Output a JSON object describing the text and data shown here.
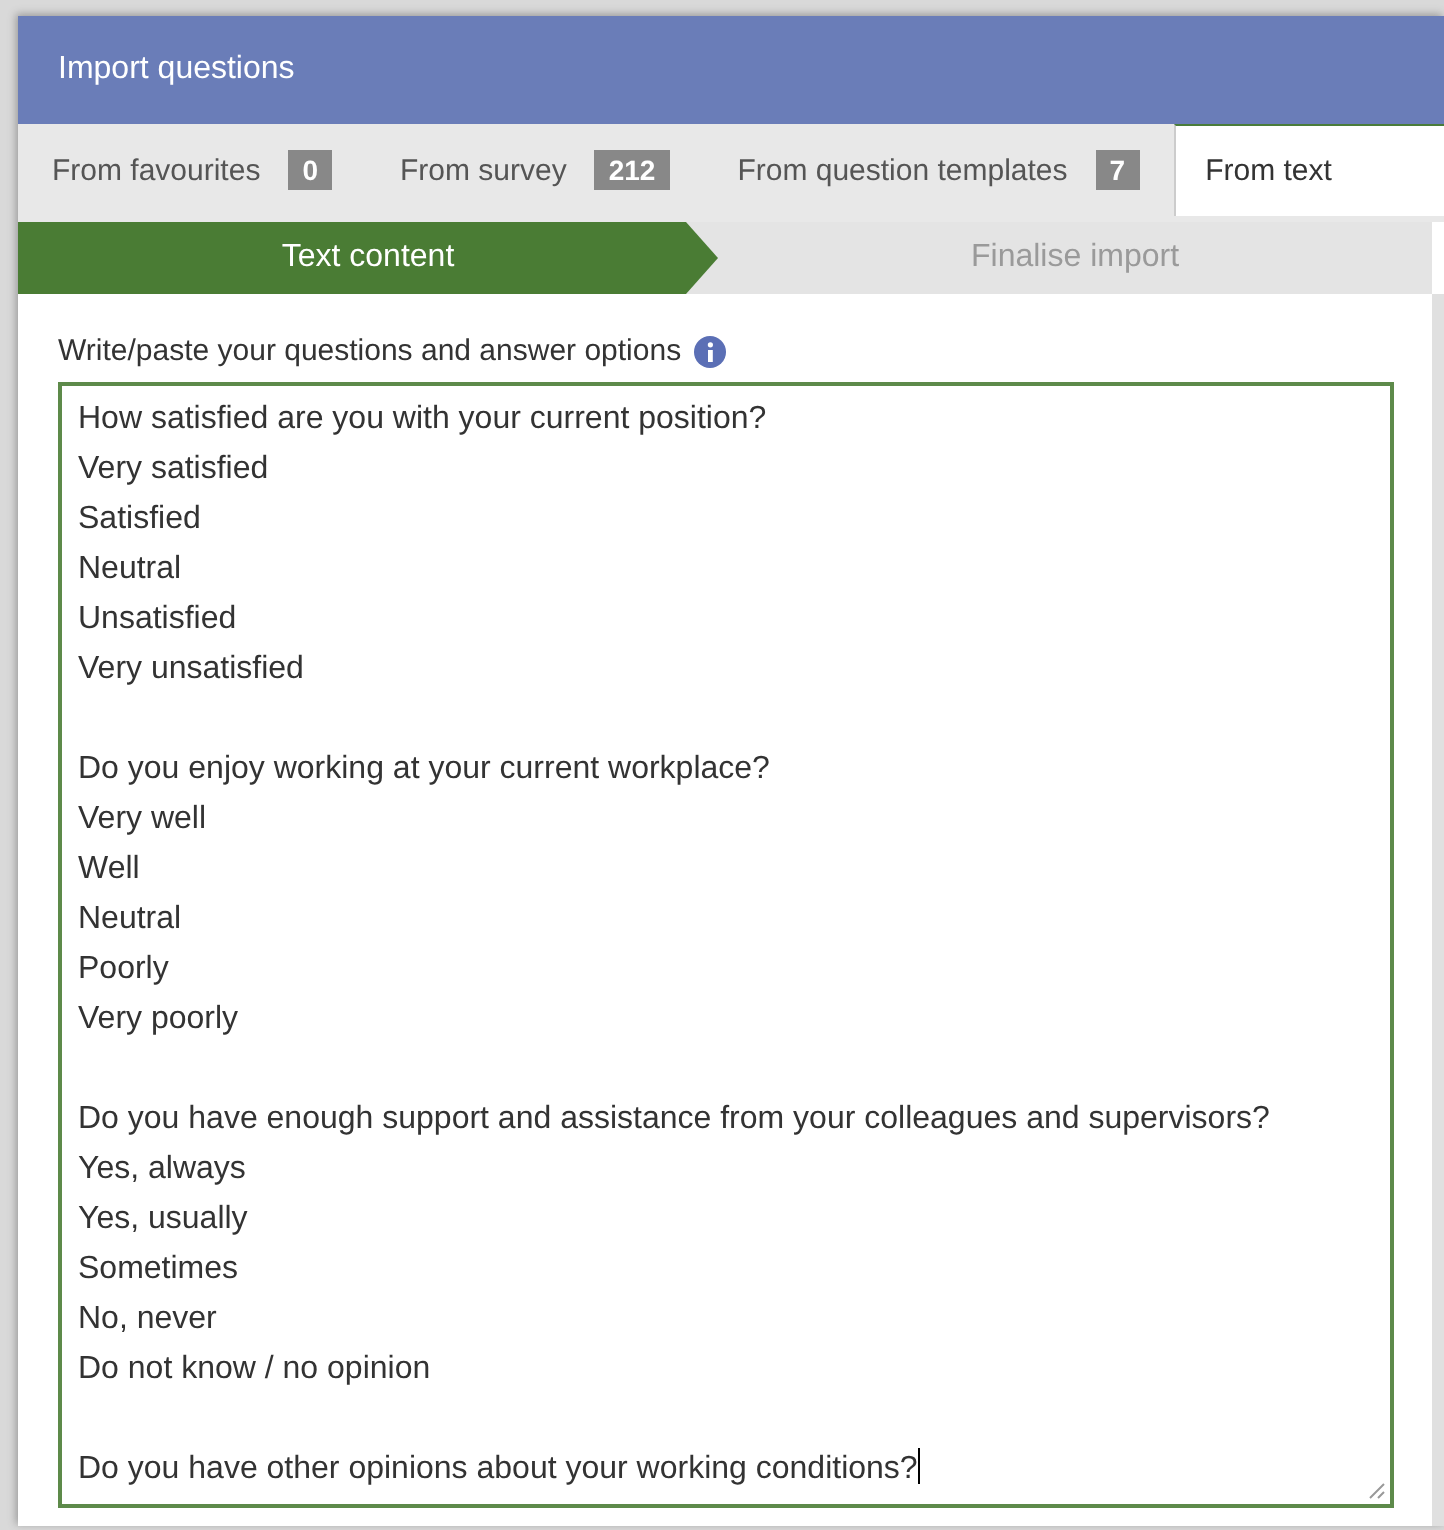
{
  "window": {
    "title": "Import questions"
  },
  "tabs": [
    {
      "label": "From favourites",
      "count": "0",
      "selected": false
    },
    {
      "label": "From survey",
      "count": "212",
      "selected": false
    },
    {
      "label": "From question templates",
      "count": "7",
      "selected": false
    },
    {
      "label": "From text",
      "selected": true
    }
  ],
  "steps": [
    {
      "label": "Text content",
      "selected": true
    },
    {
      "label": "Finalise import",
      "selected": false
    }
  ],
  "field_label": "Write/paste your questions and answer options",
  "text_field": {
    "blocks": [
      [
        "How satisfied are you with your current position?",
        "Very satisfied",
        "Satisfied",
        "Neutral",
        "Unsatisfied",
        "Very unsatisfied"
      ],
      [
        "Do you enjoy working at your current workplace?",
        "Very well",
        "Well",
        "Neutral",
        "Poorly",
        "Very poorly"
      ],
      [
        "Do you have enough support and assistance from your colleagues and supervisors?",
        "Yes, always",
        "Yes, usually",
        "Sometimes",
        "No, never",
        "Do not know / no opinion"
      ],
      [
        "Do you have other opinions about your working conditions?"
      ]
    ],
    "focused": true
  }
}
